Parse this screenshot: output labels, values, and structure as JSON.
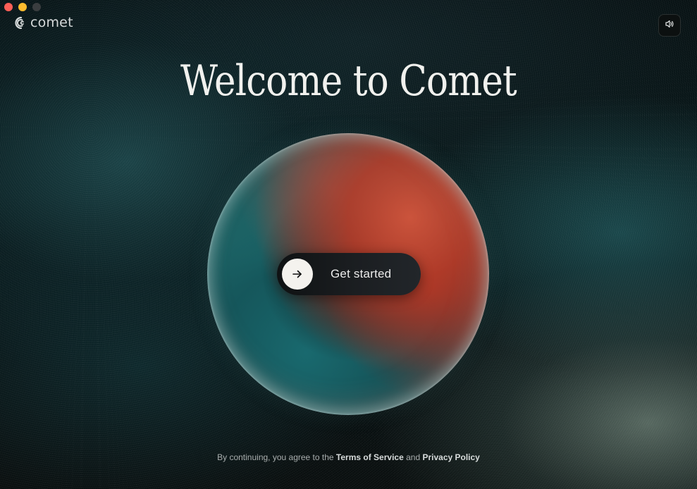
{
  "window": {
    "controls": [
      "close",
      "minimize",
      "zoom"
    ]
  },
  "brand": {
    "name": "comet",
    "logo_icon": "comet-logo-icon"
  },
  "header": {
    "sound_icon": "speaker-icon"
  },
  "hero": {
    "title": "Welcome to Comet"
  },
  "cta": {
    "icon": "arrow-right-icon",
    "label": "Get started"
  },
  "legal": {
    "prefix": "By continuing, you agree to the",
    "terms_label": "Terms of Service",
    "conjunction": "and",
    "privacy_label": "Privacy Policy"
  },
  "colors": {
    "close": "#fe5f57",
    "minimize": "#febc2e",
    "zoom": "#3a3d3f",
    "orb_red": "#c8553c",
    "orb_teal": "#1f6a6e",
    "text": "#f1f1ee"
  }
}
